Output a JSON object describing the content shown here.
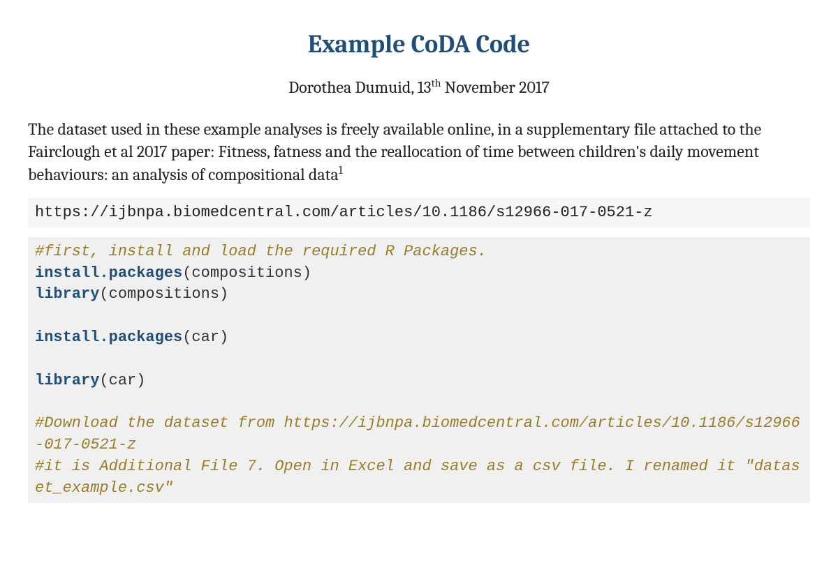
{
  "title": "Example CoDA Code",
  "byline": {
    "author": "Dorothea Dumuid",
    "date_prefix": ", 13",
    "date_ordinal": "th",
    "date_suffix": " November 2017"
  },
  "intro": {
    "text": "The dataset used in these example analyses is freely available online, in a supplementary file attached to the Fairclough et al 2017 paper: Fitness, fatness and the reallocation of time between children's daily movement behaviours: an analysis of compositional data",
    "footnote": "1"
  },
  "url": "https://ijbnpa.biomedcentral.com/articles/10.1186/s12966-017-0521-z",
  "code": {
    "comment1": "#first, install and load the required R Packages.",
    "func1": "install.packages",
    "arg1": "(compositions)",
    "func2": "library",
    "arg2": "(compositions)",
    "func3": "install.packages",
    "arg3": "(car)",
    "func4": "library",
    "arg4": "(car)",
    "comment2": "#Download the dataset from https://ijbnpa.biomedcentral.com/articles/10.1186/s12966-017-0521-z",
    "comment3": "#it is Additional File 7. Open in Excel and save as a csv file. I renamed it \"dataset_example.csv\""
  }
}
